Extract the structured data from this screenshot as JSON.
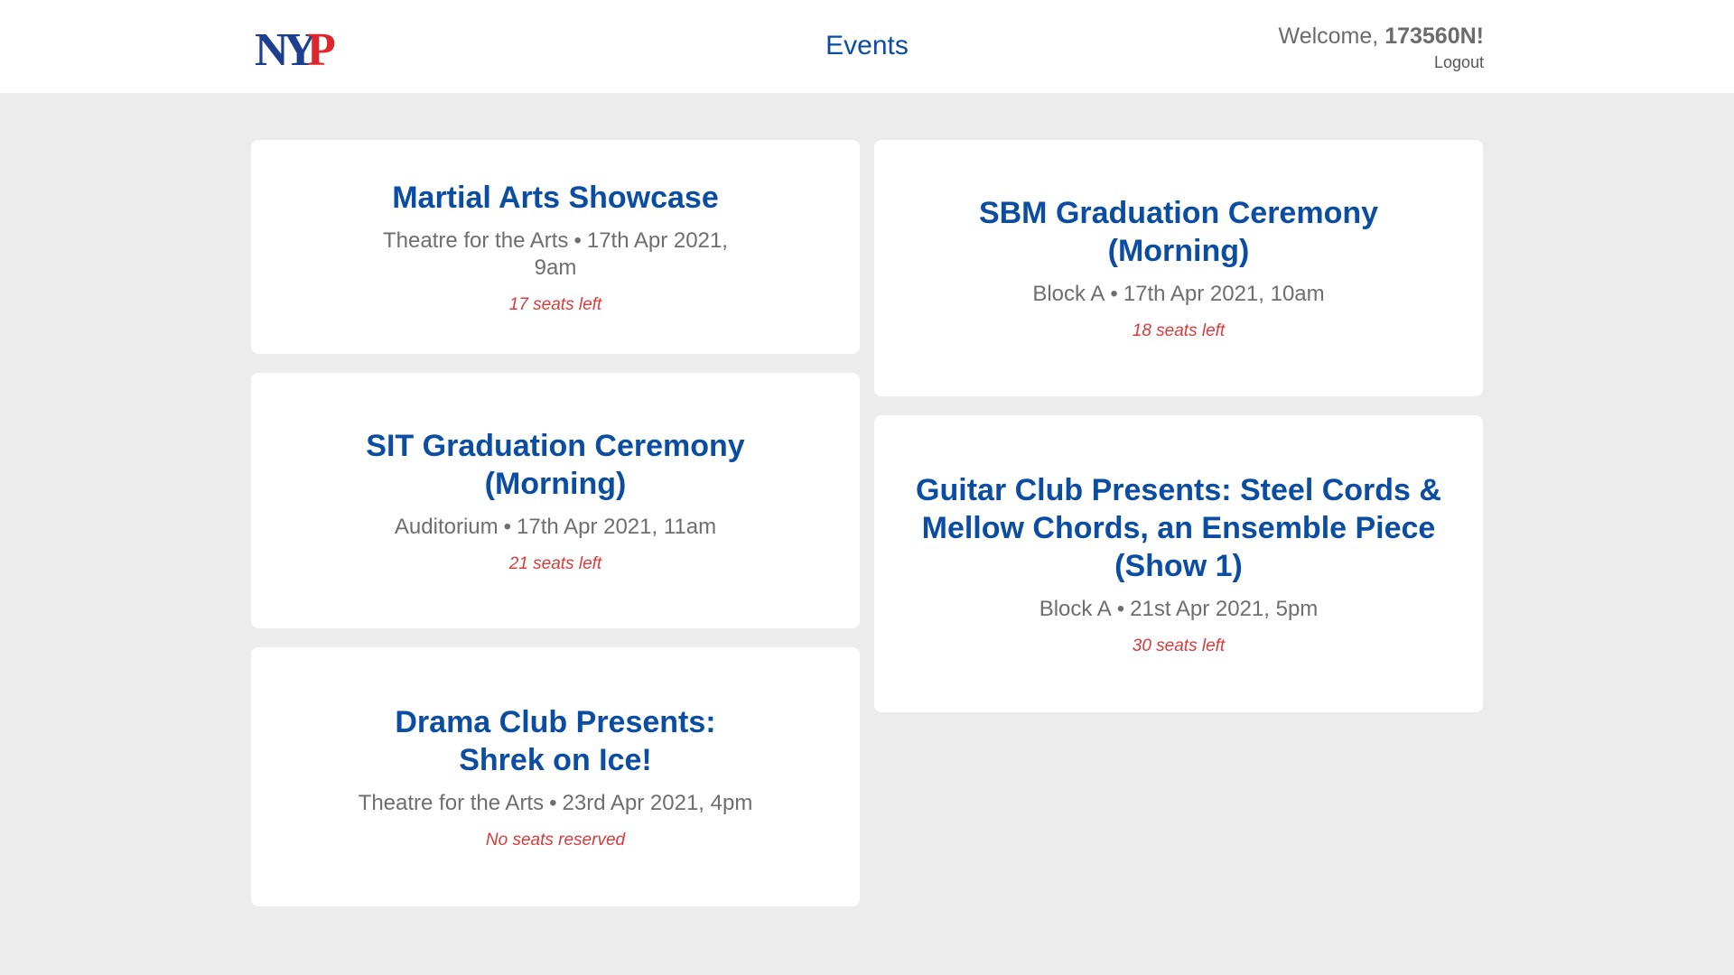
{
  "header": {
    "logo_text": "NYP",
    "title": "Events",
    "welcome_prefix": "Welcome, ",
    "username": "173560N!",
    "logout_label": "Logout"
  },
  "events": [
    {
      "title": "Martial Arts Showcase",
      "venue": "Theatre for the Arts",
      "datetime": "17th Apr 2021, 9am",
      "seats": "17 seats left"
    },
    {
      "title": "SBM Graduation Ceremony (Morning)",
      "venue": "Block A",
      "datetime": "17th Apr 2021, 10am",
      "seats": "18 seats left"
    },
    {
      "title": "SIT Graduation Ceremony (Morning)",
      "venue": "Auditorium",
      "datetime": "17th Apr 2021, 11am",
      "seats": "21 seats left"
    },
    {
      "title": "Guitar Club Presents: Steel Cords & Mellow Chords, an Ensemble Piece (Show 1)",
      "venue": "Block A",
      "datetime": "21st Apr 2021, 5pm",
      "seats": "30 seats left"
    },
    {
      "title": "Drama Club Presents: Shrek on Ice!",
      "venue": "Theatre for the Arts",
      "datetime": "23rd Apr 2021, 4pm",
      "seats": "No seats reserved"
    }
  ],
  "separator": "•",
  "colors": {
    "brand_blue": "#0a4da2",
    "brand_red": "#e0262c",
    "seats_red": "#d93a3a",
    "background": "#ececec"
  }
}
